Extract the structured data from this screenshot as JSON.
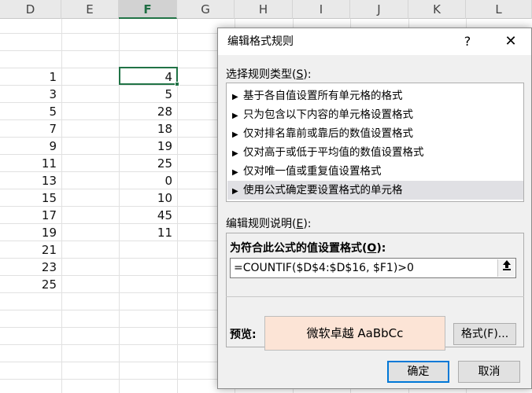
{
  "sheet": {
    "columns": [
      "D",
      "E",
      "F",
      "G",
      "H",
      "I",
      "J",
      "K",
      "L"
    ],
    "active_column": "F",
    "column_d_values": [
      "1",
      "3",
      "5",
      "7",
      "9",
      "11",
      "13",
      "15",
      "17",
      "19",
      "21",
      "23",
      "25"
    ],
    "column_f_values": [
      "4",
      "5",
      "28",
      "18",
      "19",
      "25",
      "0",
      "10",
      "45",
      "11"
    ]
  },
  "dialog": {
    "title": "编辑格式规则",
    "help_glyph": "?",
    "close_glyph": "✕",
    "select_rule_type_label": "选择规则类型(",
    "select_rule_type_key": "S",
    "select_rule_type_suffix": "):",
    "rule_types": [
      "基于各自值设置所有单元格的格式",
      "只为包含以下内容的单元格设置格式",
      "仅对排名靠前或靠后的数值设置格式",
      "仅对高于或低于平均值的数值设置格式",
      "仅对唯一值或重复值设置格式",
      "使用公式确定要设置格式的单元格"
    ],
    "selected_rule_index": 5,
    "edit_desc_label": "编辑规则说明(",
    "edit_desc_key": "E",
    "edit_desc_suffix": "):",
    "formula_label": "为符合此公式的值设置格式(",
    "formula_key": "O",
    "formula_suffix": "):",
    "formula_value": "=COUNTIF($D$4:$D$16, $F1)>0",
    "preview_label": "预览:",
    "preview_text": "微软卓越  AaBbCc",
    "preview_fill_color": "#fce4d6",
    "format_button": "格式(F)...",
    "ok_button": "确定",
    "cancel_button": "取消"
  }
}
